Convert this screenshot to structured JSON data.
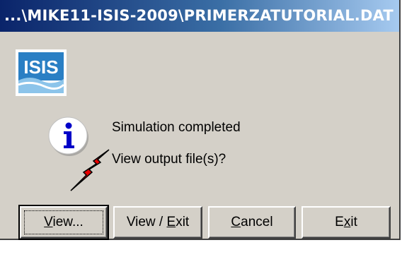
{
  "window": {
    "title": "...\\MIKE11-ISIS-2009\\PRIMERZATUTORIAL.DAT"
  },
  "logo": {
    "text": "ISIS"
  },
  "message": {
    "line1": "Simulation completed",
    "line2": "View output file(s)?"
  },
  "buttons": {
    "view": {
      "pre": "",
      "mnemonic": "V",
      "post": "iew..."
    },
    "view_exit": {
      "pre": "View / ",
      "mnemonic": "E",
      "post": "xit"
    },
    "cancel": {
      "pre": "",
      "mnemonic": "C",
      "post": "ancel"
    },
    "exit": {
      "pre": "E",
      "mnemonic": "x",
      "post": "it"
    }
  },
  "colors": {
    "dialog_bg": "#d4d0c8",
    "title_bar": "#0a246a",
    "logo_blue": "#2a7fc4",
    "info_blue": "#0000c8",
    "bolt_red": "#e60000"
  }
}
